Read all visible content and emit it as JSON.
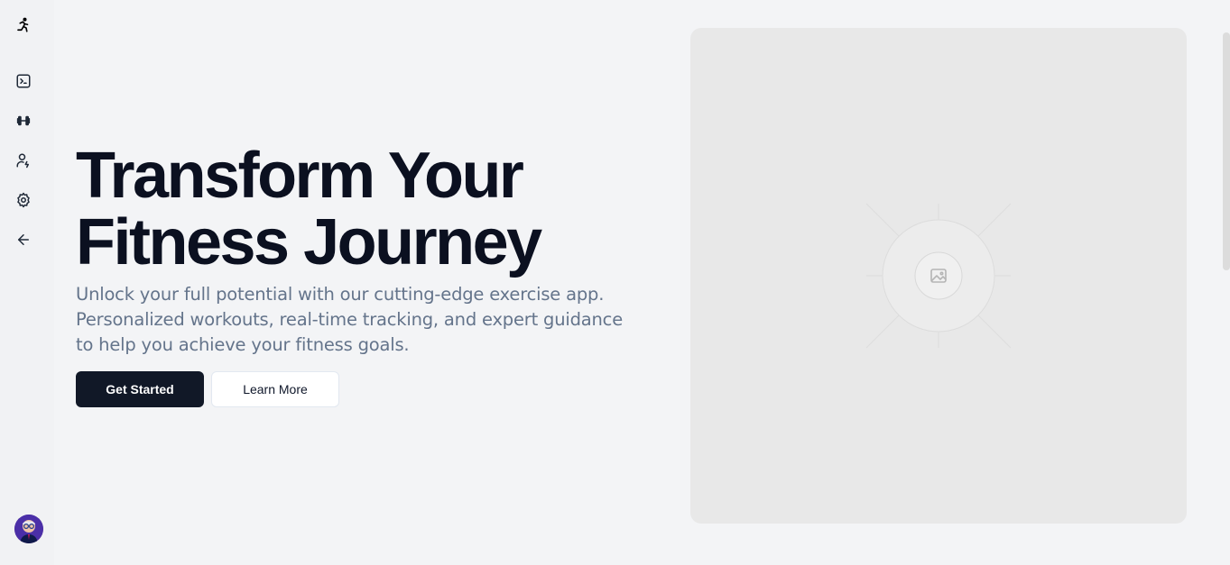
{
  "sidebar": {
    "logo_icon": "running-person-icon",
    "items": [
      {
        "icon": "terminal-icon"
      },
      {
        "icon": "dumbbell-icon"
      },
      {
        "icon": "user-check-icon"
      },
      {
        "icon": "settings-icon"
      },
      {
        "icon": "arrow-left-icon"
      }
    ],
    "avatar_icon": "user-avatar"
  },
  "hero": {
    "title_line1": "Transform Your",
    "title_line2": "Fitness Journey",
    "subtitle": "Unlock your full potential with our cutting-edge exercise app. Personalized workouts, real-time tracking, and expert guidance to help you achieve your fitness goals.",
    "primary_button": "Get Started",
    "secondary_button": "Learn More"
  },
  "image_placeholder": {
    "icon": "image-icon"
  },
  "colors": {
    "background": "#f3f4f6",
    "primary": "#111827",
    "muted_text": "#64748b",
    "placeholder_bg": "#e8e8e8"
  }
}
